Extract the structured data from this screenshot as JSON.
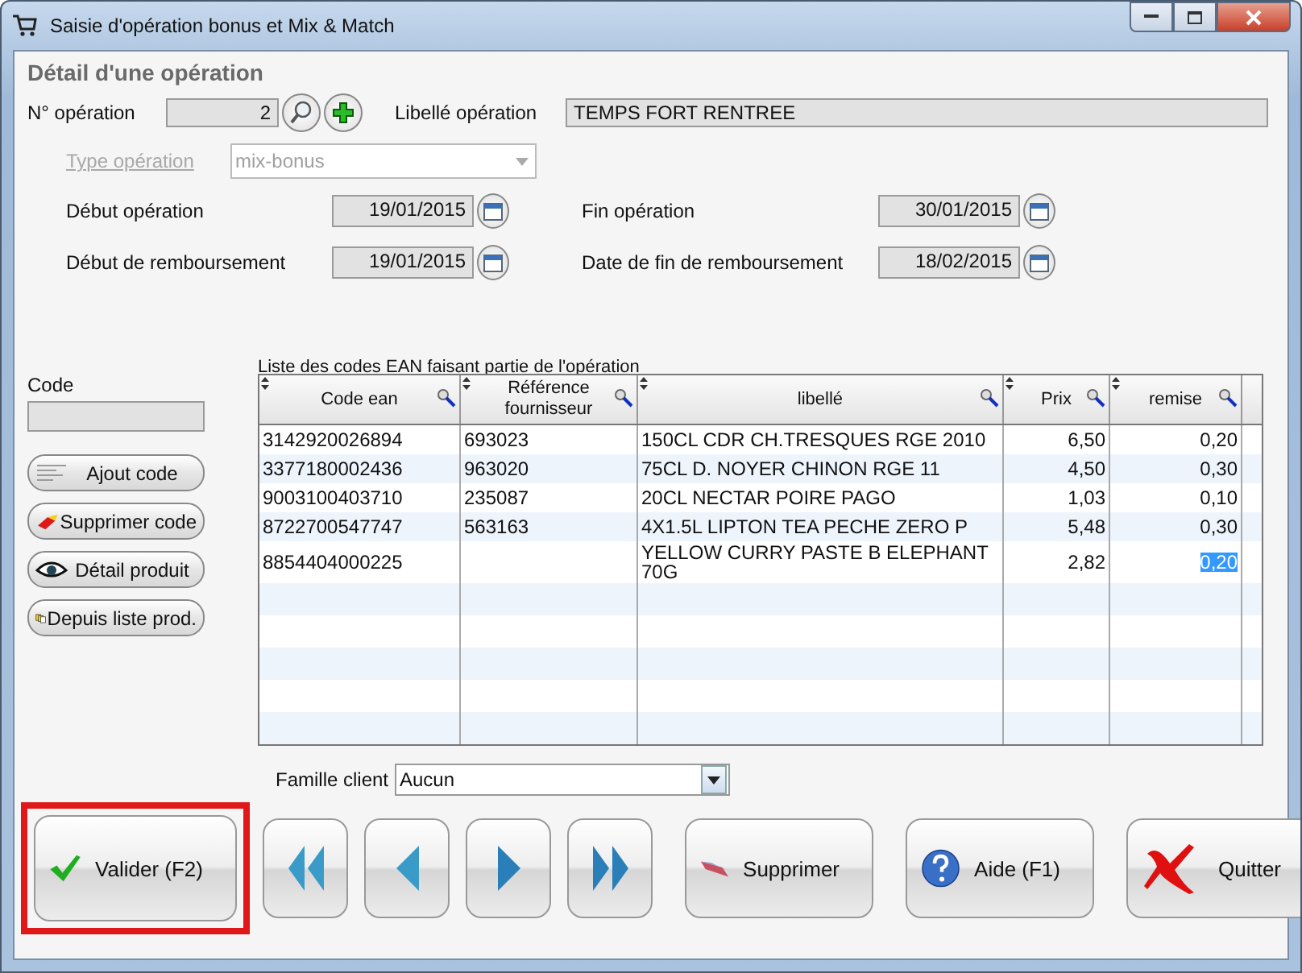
{
  "window": {
    "title": "Saisie d'opération bonus et Mix & Match"
  },
  "section_title": "Détail d'une opération",
  "operation_number": {
    "label": "N° opération",
    "value": "2"
  },
  "operation_label": {
    "label": "Libellé opération",
    "value": "TEMPS FORT RENTREE"
  },
  "operation_type": {
    "label": "Type opération",
    "value": "mix-bonus",
    "disabled": true
  },
  "dates": [
    {
      "label": "Début opération",
      "value": "19/01/2015"
    },
    {
      "label": "Fin opération",
      "value": "30/01/2015"
    },
    {
      "label": "Début de remboursement",
      "value": "19/01/2015"
    },
    {
      "label": "Date de fin de remboursement",
      "value": "18/02/2015"
    }
  ],
  "code": {
    "label": "Code"
  },
  "side_buttons": [
    {
      "label": "Ajout code",
      "kind": "add"
    },
    {
      "label": "Supprimer code",
      "kind": "erase"
    },
    {
      "label": "Détail produit",
      "kind": "eye"
    },
    {
      "label": "Depuis liste prod.",
      "kind": "list"
    }
  ],
  "table": {
    "caption": "Liste des codes EAN faisant partie de l'opération",
    "columns": [
      {
        "label": "Code ean"
      },
      {
        "label": "Référence fournisseur"
      },
      {
        "label": "libellé"
      },
      {
        "label": "Prix"
      },
      {
        "label": "remise"
      }
    ],
    "rows": [
      {
        "code_ean": "3142920026894",
        "reference": "693023",
        "libelle": "150CL CDR CH.TRESQUES RGE 2010",
        "prix": "6,50",
        "remise": "0,20",
        "editing": false
      },
      {
        "code_ean": "3377180002436",
        "reference": "963020",
        "libelle": "75CL D. NOYER CHINON RGE 11",
        "prix": "4,50",
        "remise": "0,30",
        "editing": false
      },
      {
        "code_ean": "9003100403710",
        "reference": "235087",
        "libelle": "20CL NECTAR POIRE PAGO",
        "prix": "1,03",
        "remise": "0,10",
        "editing": false
      },
      {
        "code_ean": "8722700547747",
        "reference": "563163",
        "libelle": "4X1.5L LIPTON TEA PECHE ZERO P",
        "prix": "5,48",
        "remise": "0,30",
        "editing": false
      },
      {
        "code_ean": "8854404000225",
        "libelle": "YELLOW CURRY PASTE B ELEPHANT 70G",
        "prix": "2,82",
        "remise": "0,20",
        "editing": true
      }
    ]
  },
  "client_family": {
    "label": "Famille client",
    "value": "Aucun"
  },
  "footer_buttons": [
    {
      "label": "Valider (F2)",
      "kind": "validate",
      "highlighted": true
    },
    {
      "kind": "first",
      "highlighted": false
    },
    {
      "kind": "prev",
      "highlighted": false
    },
    {
      "kind": "next",
      "highlighted": false
    },
    {
      "kind": "last",
      "highlighted": false
    },
    {
      "label": "Supprimer",
      "kind": "delete",
      "highlighted": false
    },
    {
      "label": "Aide (F1)",
      "kind": "help",
      "highlighted": false
    },
    {
      "label": "Quitter",
      "kind": "quit",
      "highlighted": false
    }
  ]
}
